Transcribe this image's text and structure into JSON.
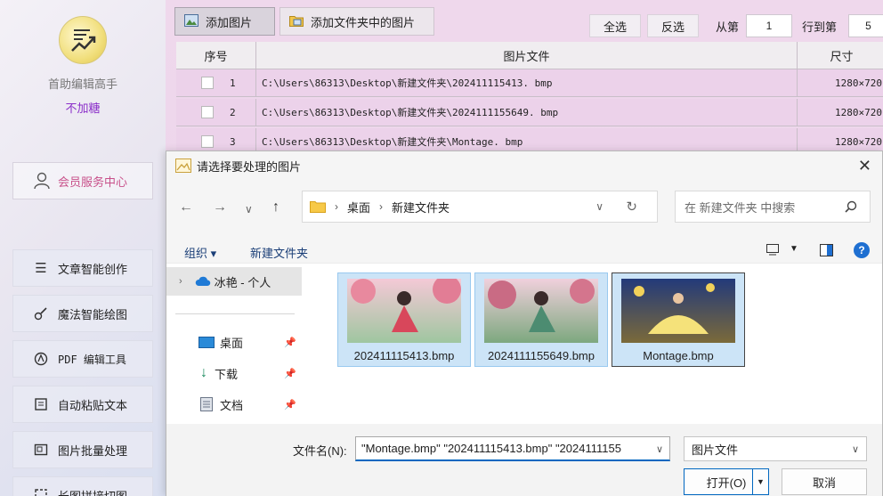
{
  "sidebar": {
    "app_name": "首助编辑高手",
    "app_sub": "不加糖",
    "member_label": "会员服务中心",
    "items": [
      {
        "label": "文章智能创作",
        "icon": "list-icon"
      },
      {
        "label": "魔法智能绘图",
        "icon": "brush-icon"
      },
      {
        "label": "PDF 编辑工具",
        "icon": "pdf-icon"
      },
      {
        "label": "自动粘贴文本",
        "icon": "paste-icon"
      },
      {
        "label": "图片批量处理",
        "icon": "image-batch-icon"
      },
      {
        "label": "长图拼接切图",
        "icon": "stitch-icon"
      }
    ]
  },
  "toolbar": {
    "add_image": "添加图片",
    "add_folder": "添加文件夹中的图片",
    "select_all": "全选",
    "invert": "反选",
    "from_label": "从第",
    "from_value": "1",
    "row_label": "行到第",
    "row_value": "5"
  },
  "grid": {
    "headers": [
      "序号",
      "图片文件",
      "尺寸"
    ],
    "rows": [
      {
        "index": "1",
        "path": "C:\\Users\\86313\\Desktop\\新建文件夹\\202411115413. bmp",
        "size": "1280×720"
      },
      {
        "index": "2",
        "path": "C:\\Users\\86313\\Desktop\\新建文件夹\\2024111155649. bmp",
        "size": "1280×720"
      },
      {
        "index": "3",
        "path": "C:\\Users\\86313\\Desktop\\新建文件夹\\Montage. bmp",
        "size": "1280×720"
      }
    ]
  },
  "dialog": {
    "title": "请选择要处理的图片",
    "breadcrumb": [
      "桌面",
      "新建文件夹"
    ],
    "search_placeholder": "在 新建文件夹 中搜索",
    "organize": "组织 ▾",
    "new_folder": "新建文件夹",
    "nav": {
      "onedrive": "冰艳 - 个人",
      "desktop": "桌面",
      "downloads": "下载",
      "documents": "文档"
    },
    "files": [
      {
        "name": "202411115413.bmp"
      },
      {
        "name": "2024111155649.bmp"
      },
      {
        "name": "Montage.bmp"
      }
    ],
    "filename_label": "文件名(N):",
    "filename_value": "\"Montage.bmp\" \"202411115413.bmp\" \"2024111155",
    "filetype": "图片文件",
    "open": "打开(O)",
    "cancel": "取消"
  }
}
